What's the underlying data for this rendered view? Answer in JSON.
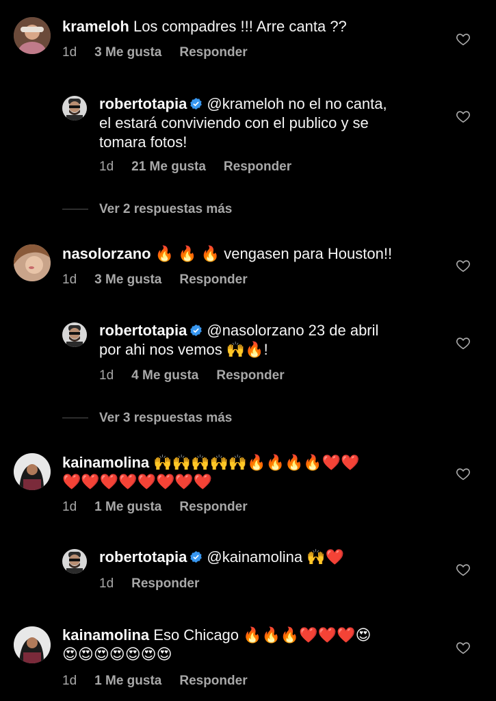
{
  "comments": [
    {
      "username": "krameloh",
      "text": "Los compadres !!! Arre canta ??",
      "time": "1d",
      "likes": "3 Me gusta",
      "reply": "Responder"
    },
    {
      "username": "robertotapia",
      "text_line1": "@krameloh no el no canta,",
      "text_line2": "el estará conviviendo con el publico y se",
      "text_line3": "tomara fotos!",
      "time": "1d",
      "likes": "21 Me gusta",
      "reply": "Responder"
    },
    {
      "view_more": "Ver 2 respuestas más"
    },
    {
      "username": "nasolorzano",
      "emojis": "🔥 🔥 🔥",
      "text": "vengasen para Houston!!",
      "time": "1d",
      "likes": "3 Me gusta",
      "reply": "Responder"
    },
    {
      "username": "robertotapia",
      "text_line1": "@nasolorzano 23 de abril",
      "text_line2": "por ahi nos vemos 🙌🔥!",
      "time": "1d",
      "likes": "4 Me gusta",
      "reply": "Responder"
    },
    {
      "view_more": "Ver 3 respuestas más"
    },
    {
      "username": "kainamolina",
      "text_line1": "🙌🙌🙌🙌🙌🔥🔥🔥🔥❤️❤️",
      "text_line2": "❤️❤️❤️❤️❤️❤️❤️❤️",
      "time": "1d",
      "likes": "1 Me gusta",
      "reply": "Responder"
    },
    {
      "username": "robertotapia",
      "text": "@kainamolina 🙌❤️",
      "time": "1d",
      "reply": "Responder"
    },
    {
      "username": "kainamolina",
      "text_line1": "Eso Chicago 🔥🔥🔥❤️❤️❤️😍",
      "text_line2": "😍😍😍😍😍😍😍",
      "time": "1d",
      "likes": "1 Me gusta",
      "reply": "Responder"
    }
  ],
  "icons": {
    "like": "heart-outline-icon",
    "verified": "verified-badge-icon"
  },
  "colors": {
    "background": "#000000",
    "text": "#f5f5f5",
    "muted": "#a8a8a8",
    "verified": "#3897f0"
  }
}
